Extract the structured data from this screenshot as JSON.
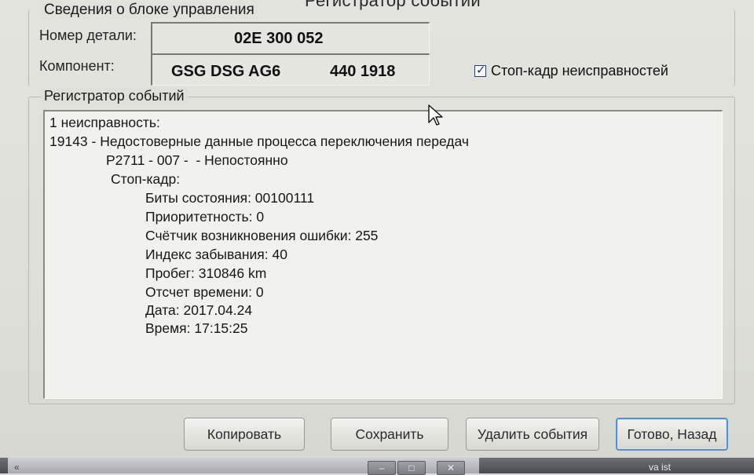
{
  "window": {
    "title": "Регистратор событий"
  },
  "control_unit": {
    "legend": "Сведения о блоке управления",
    "part_number_label": "Номер детали:",
    "part_number_value": "02E 300 052",
    "component_label": "Компонент:",
    "component_value": "GSG DSG AG6",
    "component_code": "440 1918",
    "freeze_frame_checkbox_label": "Стоп-кадр неисправностей",
    "freeze_frame_checked": true
  },
  "event_log": {
    "legend": "Регистратор событий",
    "lines": [
      "1 неисправность:",
      "19143 - Недостоверные данные процесса переключения передач",
      "P2711 - 007 -  - Непостоянно",
      "Стоп-кадр:",
      "Биты состояния: 00100111",
      "Приоритетность: 0",
      "Счётчик возникновения ошибки: 255",
      "Индекс забывания: 40",
      "Пробег: 310846 km",
      "Отсчет времени: 0",
      "Дата: 2017.04.24",
      "Время: 17:15:25"
    ]
  },
  "buttons": {
    "copy": "Копировать",
    "save": "Сохранить",
    "delete_events": "Удалить события",
    "done_back": "Готово, Назад"
  },
  "taskbar": {
    "left_glyph": "«",
    "close_glyph": "✕",
    "right_text": "va ist"
  },
  "colors": {
    "window_bg": "#dedfd9",
    "default_button_border": "#5b8fc6",
    "checkbox_check": "#1c2e8a"
  }
}
